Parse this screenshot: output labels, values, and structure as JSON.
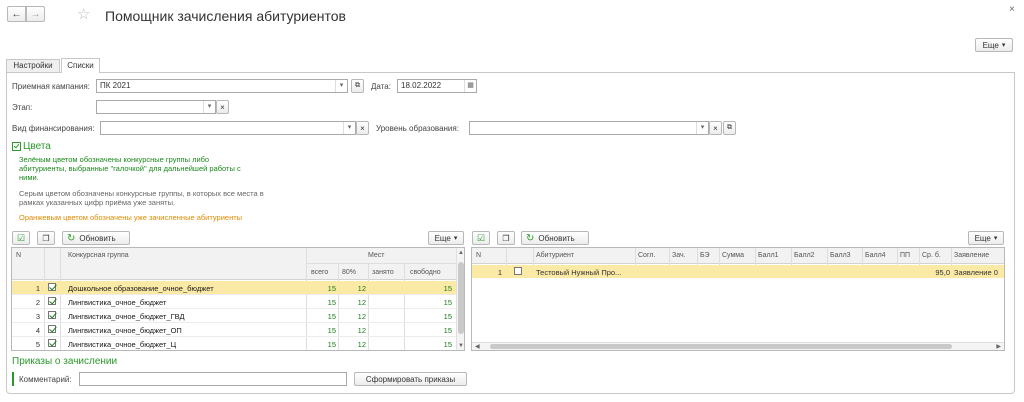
{
  "window": {
    "title": "Помощник зачисления абитуриентов",
    "close_glyph": "×",
    "more_label": "Еще",
    "dropdown_glyph": "▾"
  },
  "tabs": [
    "Настройки",
    "Списки"
  ],
  "form": {
    "campaign_label": "Приемная кампания:",
    "campaign_value": "ПК 2021",
    "date_label": "Дата:",
    "date_value": "18.02.2022",
    "stage_label": "Этап:",
    "stage_value": "",
    "financing_label": "Вид финансирования:",
    "financing_value": "",
    "education_label": "Уровень образования:",
    "education_value": "",
    "clear_glyph": "×"
  },
  "colors_section": {
    "title": "Цвета",
    "green_text": "Зелёным цветом обозначены конкурсные группы либо абитуриенты, выбранные \"галочкой\" для дальнейшей работы с ними.",
    "gray_text": "Серым цветом обозначены конкурсные группы, в которых все места в рамках указанных цифр приёма уже заняты.",
    "orange_text": "Оранжевым цветом обозначены уже зачисленные абитуриенты"
  },
  "left_table": {
    "refresh_label": "Обновить",
    "more_label": "Еще",
    "headers": {
      "n": "N",
      "group": "Конкурсная группа",
      "places": "Мест",
      "total": "всего",
      "pct80": "80%",
      "taken": "занято",
      "free": "свободно"
    },
    "rows": [
      {
        "n": "1",
        "checked": true,
        "group": "Дошкольное образование_очное_бюджет",
        "total": "15",
        "pct80": "12",
        "taken": "",
        "free": "15"
      },
      {
        "n": "2",
        "checked": true,
        "group": "Лингвистика_очное_бюджет",
        "total": "15",
        "pct80": "12",
        "taken": "",
        "free": "15"
      },
      {
        "n": "3",
        "checked": true,
        "group": "Лингвистика_очное_бюджет_ГВД",
        "total": "15",
        "pct80": "12",
        "taken": "",
        "free": "15"
      },
      {
        "n": "4",
        "checked": true,
        "group": "Лингвистика_очное_бюджет_ОП",
        "total": "15",
        "pct80": "12",
        "taken": "",
        "free": "15"
      },
      {
        "n": "5",
        "checked": true,
        "group": "Лингвистика_очное_бюджет_Ц",
        "total": "15",
        "pct80": "12",
        "taken": "",
        "free": "15"
      }
    ]
  },
  "right_table": {
    "refresh_label": "Обновить",
    "more_label": "Еще",
    "headers": [
      "N",
      "Абитуриент",
      "Согл.",
      "Зач.",
      "БЭ",
      "Сумма",
      "Балл1",
      "Балл2",
      "Балл3",
      "Балл4",
      "ПП",
      "Ср. б.",
      "Заявление"
    ],
    "rows": [
      {
        "n": "1",
        "checked": false,
        "applicant": "Тестовый Нужный Про...",
        "avg": "95,0",
        "application": "Заявление 0"
      }
    ]
  },
  "orders": {
    "title": "Приказы о зачислении",
    "comment_label": "Комментарий:",
    "comment_value": "",
    "create_button": "Сформировать приказы"
  },
  "colors": {
    "accent_green": "#2b9a2b",
    "orange": "#e08a00",
    "selected_row": "#fbe9a6"
  }
}
